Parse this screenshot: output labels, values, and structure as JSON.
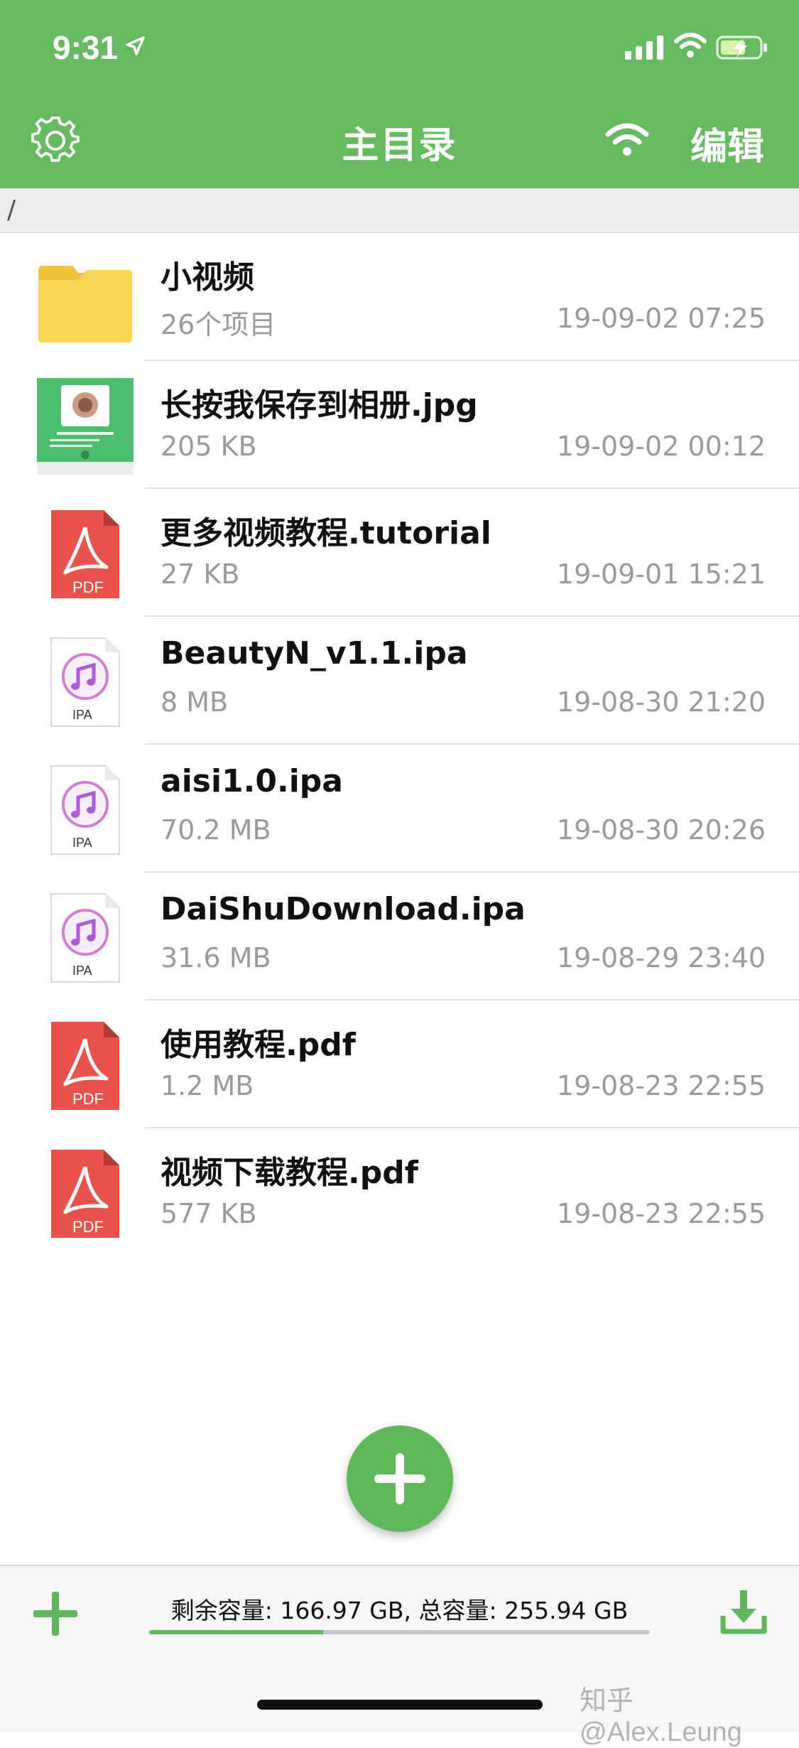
{
  "status_bar": {
    "time": "9:31"
  },
  "header": {
    "title": "主目录",
    "edit_label": "编辑"
  },
  "path": "/",
  "files": [
    {
      "name": "小视频",
      "meta": "26个项目",
      "date": "19-09-02 07:25",
      "icon": "folder-icon"
    },
    {
      "name": "长按我保存到相册.jpg",
      "meta": "205 KB",
      "date": "19-09-02 00:12",
      "icon": "image-thumbnail"
    },
    {
      "name": "更多视频教程.tutorial",
      "meta": "27 KB",
      "date": "19-09-01 15:21",
      "icon": "pdf-icon",
      "icon_label": "PDF"
    },
    {
      "name": "BeautyN_v1.1.ipa",
      "meta": "8 MB",
      "date": "19-08-30 21:20",
      "icon": "ipa-icon",
      "icon_label": "IPA"
    },
    {
      "name": "aisi1.0.ipa",
      "meta": "70.2 MB",
      "date": "19-08-30 20:26",
      "icon": "ipa-icon",
      "icon_label": "IPA"
    },
    {
      "name": "DaiShuDownload.ipa",
      "meta": "31.6 MB",
      "date": "19-08-29 23:40",
      "icon": "ipa-icon",
      "icon_label": "IPA"
    },
    {
      "name": "使用教程.pdf",
      "meta": "1.2 MB",
      "date": "19-08-23 22:55",
      "icon": "pdf-icon",
      "icon_label": "PDF"
    },
    {
      "name": "视频下载教程.pdf",
      "meta": "577 KB",
      "date": "19-08-23 22:55",
      "icon": "pdf-icon",
      "icon_label": "PDF"
    }
  ],
  "storage": {
    "text": "剩余容量: 166.97 GB, 总容量: 255.94 GB",
    "free_gb": 166.97,
    "total_gb": 255.94,
    "used_fraction": 0.348
  },
  "watermark": "知乎 @Alex.Leung",
  "colors": {
    "accent": "#66bb60",
    "pdf_red": "#e8524a",
    "folder_yellow": "#f7d452"
  }
}
